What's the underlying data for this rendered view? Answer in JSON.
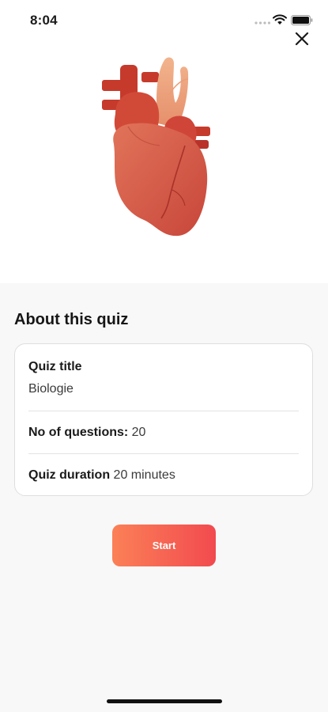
{
  "status_bar": {
    "time": "8:04"
  },
  "icons": {
    "close": "close-icon",
    "wifi": "wifi-icon",
    "battery": "battery-icon",
    "signal": "signal-icon"
  },
  "section_title": "About this quiz",
  "card": {
    "title_label": "Quiz title",
    "title_value": "Biologie",
    "questions_label": "No of questions:",
    "questions_value": "20",
    "duration_label": "Quiz duration",
    "duration_value": "20 minutes"
  },
  "start_button_label": "Start",
  "colors": {
    "accent_start": "#fb8057",
    "accent_end": "#f24a4f",
    "background": "#f8f8f8",
    "card": "#ffffff"
  }
}
